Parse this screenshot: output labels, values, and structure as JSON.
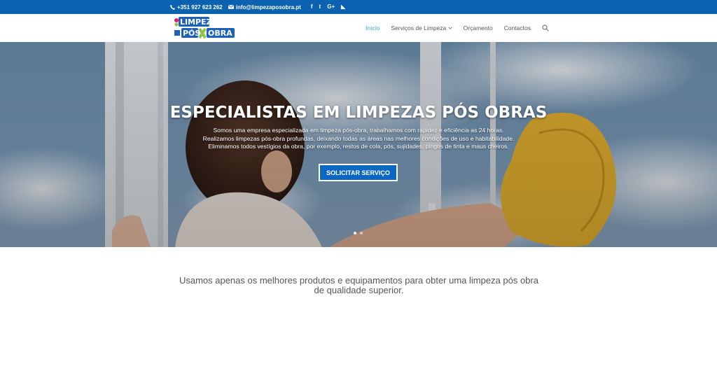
{
  "topbar": {
    "phone": "+351 927 623 262",
    "email": "info@limpezaposobra.pt",
    "social": [
      {
        "icon": "facebook-icon",
        "glyph": "f"
      },
      {
        "icon": "twitter-icon",
        "glyph": "t"
      },
      {
        "icon": "google-plus-icon",
        "glyph": "G+"
      },
      {
        "icon": "rss-icon",
        "glyph": "◣"
      }
    ]
  },
  "logo": {
    "line1": "LIMPEZA",
    "line2": "PÓS",
    "line3": "OBRA"
  },
  "nav": {
    "items": [
      "Início",
      "Serviços de Limpeza",
      "Orçamento",
      "Contactos"
    ]
  },
  "hero": {
    "title": "ESPECIALISTAS EM LIMPEZAS PÓS OBRAS",
    "text": "Somos uma empresa especializada em limpeza pós-obra, trabalhamos com rapidez e eficiência as 24 horas. Realizamos limpezas pós-obra profundas, deixando todas as áreas nas melhores condições de uso e habitabilidade. Eliminamos todos vestígios da obra, por exemplo, restos de cola, pós, sujidades, pingos de tinta e maus cheiros.",
    "button": "SOLICITAR SERVIÇO"
  },
  "intro": {
    "text": "Usamos apenas os melhores produtos e equipamentos para obter uma limpeza pós obra de qualidade superior."
  },
  "colors": {
    "topbar": "#0a62b0",
    "accent": "#2ea3f2",
    "button": "#0a67c2"
  }
}
